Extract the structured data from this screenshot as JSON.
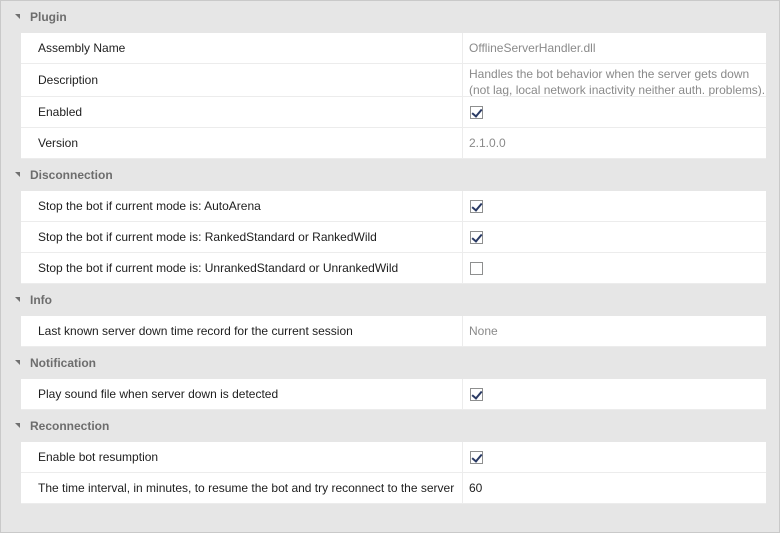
{
  "sections": [
    {
      "title": "Plugin",
      "rows": [
        {
          "name": "Assembly Name",
          "value": "OfflineServerHandler.dll"
        },
        {
          "name": "Description",
          "value": "Handles the bot behavior when the server gets down (not lag, local network inactivity neither auth. problems)."
        },
        {
          "name": "Enabled",
          "checked": true
        },
        {
          "name": "Version",
          "value": "2.1.0.0"
        }
      ]
    },
    {
      "title": "Disconnection",
      "rows": [
        {
          "name": "Stop the bot if current mode is: AutoArena",
          "checked": true
        },
        {
          "name": "Stop the bot if current mode is: RankedStandard or RankedWild",
          "checked": true
        },
        {
          "name": "Stop the bot if current mode is: UnrankedStandard or UnrankedWild",
          "checked": false
        }
      ]
    },
    {
      "title": "Info",
      "rows": [
        {
          "name": "Last known server down time record for the current session",
          "value": "None"
        }
      ]
    },
    {
      "title": "Notification",
      "rows": [
        {
          "name": "Play sound file when server down is detected",
          "checked": true
        }
      ]
    },
    {
      "title": "Reconnection",
      "rows": [
        {
          "name": "Enable bot resumption",
          "checked": true
        },
        {
          "name": "The time interval, in minutes, to resume the bot and try reconnect to the server",
          "value": "60"
        }
      ]
    }
  ]
}
